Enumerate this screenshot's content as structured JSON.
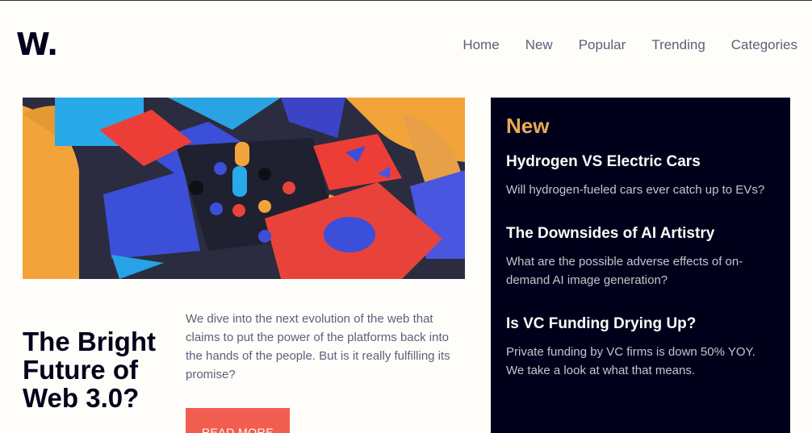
{
  "logo": "W.",
  "nav": [
    "Home",
    "New",
    "Popular",
    "Trending",
    "Categories"
  ],
  "hero": {
    "headline_lines": [
      "The Bright",
      "Future of",
      "Web 3.0?"
    ],
    "description": "We dive into the next evolution of the web that claims to put the power of the platforms back into the hands of the people. But is it really fulfilling its promise?",
    "cta": "READ MORE"
  },
  "sidebar": {
    "title": "New",
    "items": [
      {
        "title": "Hydrogen VS Electric Cars",
        "text": "Will hydrogen-fueled cars ever catch up to EVs?"
      },
      {
        "title": "The Downsides of AI Artistry",
        "text": "What are the possible adverse effects of on-demand AI image generation?"
      },
      {
        "title": "Is VC Funding Drying Up?",
        "text": "Private funding by VC firms is down 50% YOY. We take a look at what that means."
      }
    ]
  },
  "colors": {
    "background": "#fffdfa",
    "dark": "#00001a",
    "accent_orange": "#e9ab53",
    "accent_red": "#f15e50",
    "muted_text": "#5d5f79"
  },
  "icons": {
    "hero_image": "abstract-3d-blocks-illustration"
  }
}
